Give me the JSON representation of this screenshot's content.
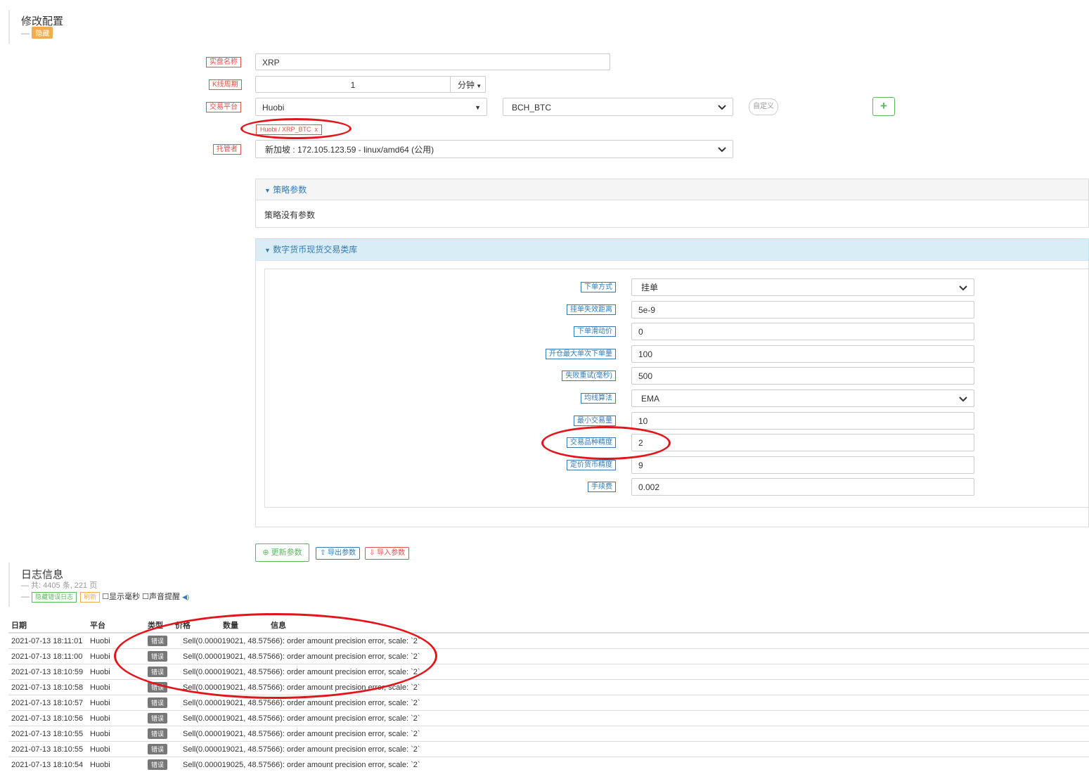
{
  "config": {
    "title": "修改配置",
    "dash": "—",
    "hide_badge": "隐藏",
    "labels": {
      "name": "实盘名称",
      "period": "K线周期",
      "exchange": "交易平台",
      "docker": "托管者"
    },
    "name_value": "XRP",
    "period_value": "1",
    "period_unit": "分钟",
    "exchange_value": "Huobi",
    "pair_value": "BCH_BTC",
    "custom_label": "自定义",
    "add_icon": "+",
    "selected_tag": "Huobi / XRP_BTC",
    "tag_close": "x",
    "docker_value": "新加坡 : 172.105.123.59 - linux/amd64 (公用)"
  },
  "strategy_panel": {
    "header": "策略参数",
    "body": "策略没有参数"
  },
  "lib_panel": {
    "header": "数字货币现货交易类库",
    "params": [
      {
        "label": "下单方式",
        "value": "挂单",
        "select": true
      },
      {
        "label": "挂单失效距离",
        "value": "5e-9"
      },
      {
        "label": "下单滑动价",
        "value": "0"
      },
      {
        "label": "开仓最大单次下单量",
        "value": "100"
      },
      {
        "label": "失败重试(毫秒)",
        "value": "500"
      },
      {
        "label": "均线算法",
        "value": "EMA",
        "select": true
      },
      {
        "label": "最小交易量",
        "value": "10"
      },
      {
        "label": "交易品种精度",
        "value": "2"
      },
      {
        "label": "定价货币精度",
        "value": "9"
      },
      {
        "label": "手续费",
        "value": "0.002"
      }
    ]
  },
  "actions": {
    "update": "更新参数",
    "export": "导出参数",
    "import": "导入参数"
  },
  "log": {
    "title": "日志信息",
    "summary": "— 共: 4405 条, 221 页",
    "hide_error": "隐藏错误日志",
    "refresh": "刷新",
    "show_ms": "显示毫秒",
    "sound": "声音提醒",
    "columns": [
      "日期",
      "平台",
      "类型",
      "价格",
      "数量",
      "信息"
    ],
    "rows": [
      {
        "date": "2021-07-13 18:11:01",
        "platform": "Huobi",
        "type": "错误",
        "msg": "Sell(0.000019021, 48.57566): order amount precision error, scale: `2`"
      },
      {
        "date": "2021-07-13 18:11:00",
        "platform": "Huobi",
        "type": "错误",
        "msg": "Sell(0.000019021, 48.57566): order amount precision error, scale: `2`"
      },
      {
        "date": "2021-07-13 18:10:59",
        "platform": "Huobi",
        "type": "错误",
        "msg": "Sell(0.000019021, 48.57566): order amount precision error, scale: `2`"
      },
      {
        "date": "2021-07-13 18:10:58",
        "platform": "Huobi",
        "type": "错误",
        "msg": "Sell(0.000019021, 48.57566): order amount precision error, scale: `2`"
      },
      {
        "date": "2021-07-13 18:10:57",
        "platform": "Huobi",
        "type": "错误",
        "msg": "Sell(0.000019021, 48.57566): order amount precision error, scale: `2`"
      },
      {
        "date": "2021-07-13 18:10:56",
        "platform": "Huobi",
        "type": "错误",
        "msg": "Sell(0.000019021, 48.57566): order amount precision error, scale: `2`"
      },
      {
        "date": "2021-07-13 18:10:55",
        "platform": "Huobi",
        "type": "错误",
        "msg": "Sell(0.000019021, 48.57566): order amount precision error, scale: `2`"
      },
      {
        "date": "2021-07-13 18:10:55",
        "platform": "Huobi",
        "type": "错误",
        "msg": "Sell(0.000019021, 48.57566): order amount precision error, scale: `2`"
      },
      {
        "date": "2021-07-13 18:10:54",
        "platform": "Huobi",
        "type": "错误",
        "msg": "Sell(0.000019025, 48.57566): order amount precision error, scale: `2`"
      }
    ]
  },
  "colors": {
    "annotation": "#e3141a",
    "label_red": "#d9534f",
    "label_blue": "#337ab7"
  }
}
